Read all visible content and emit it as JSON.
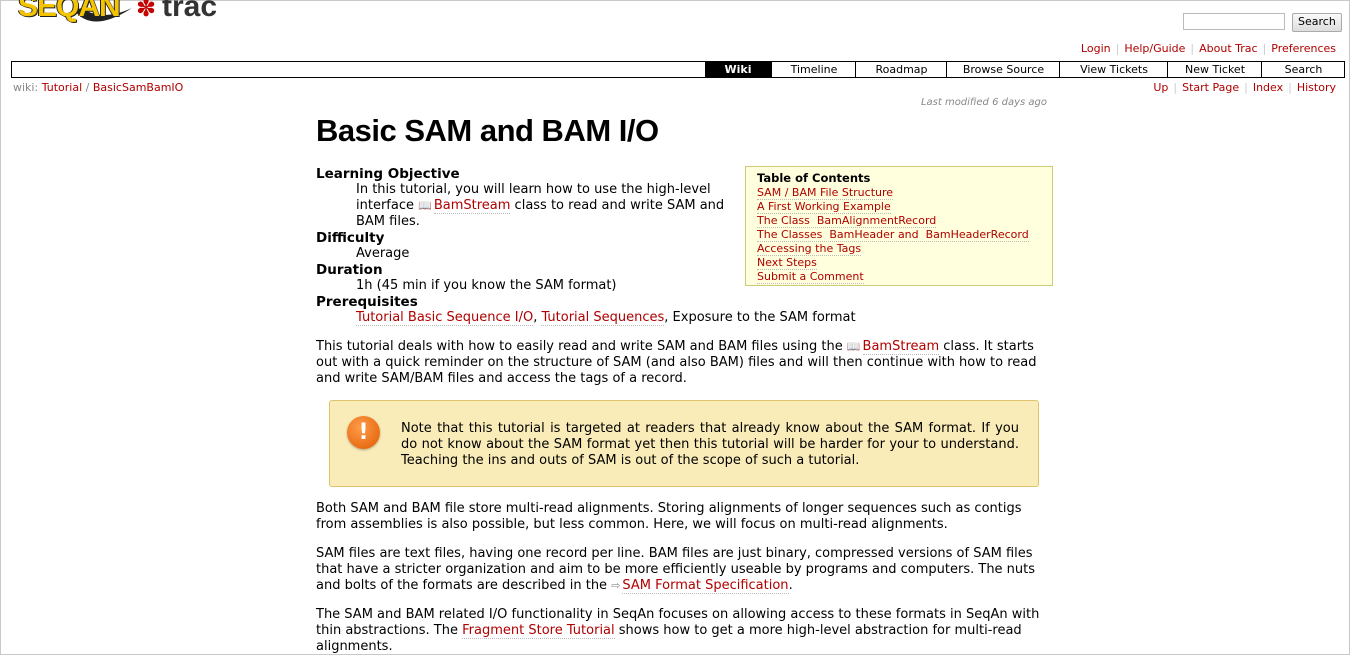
{
  "logo": {
    "seqan": "SEQAN",
    "trac": "trac"
  },
  "header": {
    "search_placeholder": "",
    "search_button": "Search",
    "metanav": [
      "Login",
      "Help/Guide",
      "About Trac",
      "Preferences"
    ]
  },
  "mainnav": [
    {
      "label": "Wiki",
      "active": true
    },
    {
      "label": "Timeline",
      "active": false
    },
    {
      "label": "Roadmap",
      "active": false
    },
    {
      "label": "Browse Source",
      "active": false
    },
    {
      "label": "View Tickets",
      "active": false
    },
    {
      "label": "New Ticket",
      "active": false
    },
    {
      "label": "Search",
      "active": false
    }
  ],
  "breadcrumb": {
    "prefix": "wiki:",
    "items": [
      "Tutorial",
      "BasicSamBamIO"
    ],
    "sep": "/"
  },
  "ctxnav": [
    "Up",
    "Start Page",
    "Index",
    "History"
  ],
  "last_modified": "Last modified 6 days ago",
  "page": {
    "title": "Basic SAM and BAM I/O",
    "lo_term": "Learning Objective",
    "lo_text1": "In this tutorial, you will learn how to use the high-level interface ",
    "lo_link": "BamStream",
    "lo_text2": " class to read and write SAM and BAM files.",
    "difficulty_term": "Difficulty",
    "difficulty": "Average",
    "duration_term": "Duration",
    "duration": "1h (45 min if you know the SAM format)",
    "prereq_term": "Prerequisites",
    "prereq_link1": "Tutorial Basic Sequence I/O",
    "prereq_sep": ", ",
    "prereq_link2": "Tutorial Sequences",
    "prereq_text": ", Exposure to the SAM format",
    "intro1": "This tutorial deals with how to easily read and write SAM and BAM files using the ",
    "intro_link": "BamStream",
    "intro2": " class. It starts out with a quick reminder on the structure of SAM (and also BAM) files and will then continue with how to read and write SAM/BAM files and access the tags of a record.",
    "note": "Note that this tutorial is targeted at readers that already know about the SAM format. If you do not know about the SAM format yet then this tutorial will be harder for your to understand. Teaching the ins and outs of SAM is out of the scope of such a tutorial.",
    "p1": "Both SAM and BAM file store multi-read alignments. Storing alignments of longer sequences such as contigs from assemblies is also possible, but less common. Here, we will focus on multi-read alignments.",
    "p2a": "SAM files are text files, having one record per line. BAM files are just binary, compressed versions of SAM files that have a stricter organization and aim to be more efficiently useable by programs and computers. The nuts and bolts of the formats are described in the ",
    "p2_link": "SAM Format Specification",
    "p2b": ".",
    "p3a": "The SAM and BAM related I/O functionality in SeqAn focuses on allowing access to these formats in SeqAn with thin abstractions. The ",
    "p3_link": "Fragment Store Tutorial",
    "p3b": " shows how to get a more high-level abstraction for multi-read alignments."
  },
  "toc": {
    "title": "Table of Contents",
    "items": [
      "SAM / BAM File Structure",
      "A First Working Example",
      "The Class  BamAlignmentRecord",
      "The Classes  BamHeader and  BamHeaderRecord",
      "Accessing the Tags",
      "Next Steps",
      "Submit a Comment"
    ]
  }
}
